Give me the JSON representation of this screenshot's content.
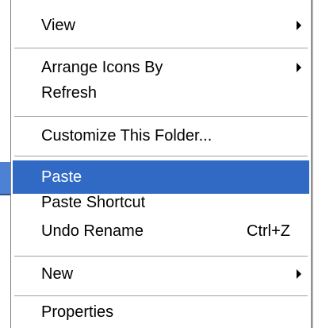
{
  "menu": {
    "items": {
      "view": {
        "label": "View"
      },
      "arrange_icons_by": {
        "label": "Arrange Icons By"
      },
      "refresh": {
        "label": "Refresh"
      },
      "customize_this_folder": {
        "label": "Customize This Folder..."
      },
      "paste": {
        "label": "Paste"
      },
      "paste_shortcut": {
        "label": "Paste Shortcut"
      },
      "undo_rename": {
        "label": "Undo Rename",
        "shortcut": "Ctrl+Z"
      },
      "new": {
        "label": "New"
      },
      "properties": {
        "label": "Properties"
      }
    },
    "selected_item": "Paste",
    "highlight_color": "#316ac5"
  }
}
